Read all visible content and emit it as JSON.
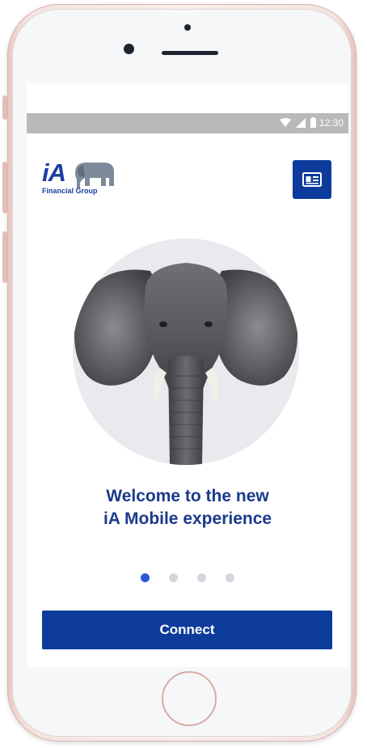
{
  "status_bar": {
    "time": "12:30"
  },
  "header": {
    "logo_mark": "iA",
    "logo_subtitle": "Financial Group",
    "card_icon": "id-card-icon"
  },
  "hero": {
    "image": "elephant-photo"
  },
  "welcome": {
    "line1": "Welcome to the new",
    "line2": "iA Mobile experience"
  },
  "pagination": {
    "count": 4,
    "active_index": 0
  },
  "actions": {
    "connect_label": "Connect"
  },
  "colors": {
    "brand_blue": "#0d3b9c",
    "heading_blue": "#1b3a8c",
    "dot_active": "#2a57d6",
    "dot_inactive": "#d3d6dc"
  }
}
